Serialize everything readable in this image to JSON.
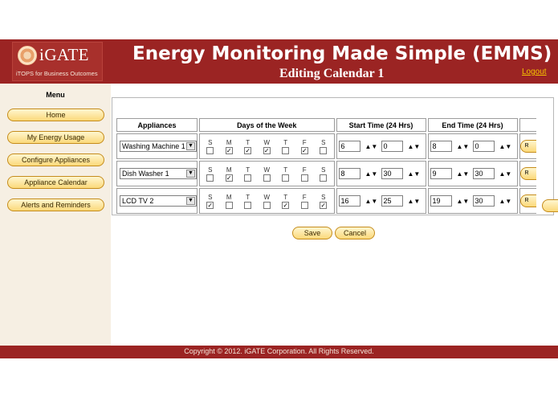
{
  "header": {
    "logo_text": "iGATE",
    "logo_tagline": "iTOPS for Business Outcomes",
    "app_title": "Energy Monitoring Made Simple (EMMS)",
    "page_subtitle": "Editing Calendar 1",
    "logout_label": "Logout"
  },
  "sidebar": {
    "menu_title": "Menu",
    "items": [
      {
        "label": "Home"
      },
      {
        "label": "My Energy Usage"
      },
      {
        "label": "Configure Appliances"
      },
      {
        "label": "Appliance Calendar"
      },
      {
        "label": "Alerts and Reminders"
      }
    ]
  },
  "schedule": {
    "headers": {
      "appliances": "Appliances",
      "days": "Days of the Week",
      "start": "Start Time (24 Hrs)",
      "end": "End Time (24 Hrs)"
    },
    "day_letters": [
      "S",
      "M",
      "T",
      "W",
      "T",
      "F",
      "S"
    ],
    "rows": [
      {
        "appliance": "Washing Machine 1",
        "days": [
          "",
          "✓",
          "✓",
          "✓",
          "",
          "✓",
          ""
        ],
        "start_hour": "6",
        "start_min": "0",
        "end_hour": "8",
        "end_min": "0",
        "row_button": "R"
      },
      {
        "appliance": "Dish Washer 1",
        "days": [
          "",
          "✓",
          "",
          "",
          "",
          "",
          ""
        ],
        "start_hour": "8",
        "start_min": "30",
        "end_hour": "9",
        "end_min": "30",
        "row_button": "R"
      },
      {
        "appliance": "LCD TV 2",
        "days": [
          "✓",
          "",
          "",
          "",
          "✓",
          "",
          "✓"
        ],
        "start_hour": "16",
        "start_min": "25",
        "end_hour": "19",
        "end_min": "30",
        "row_button": "R"
      }
    ],
    "select_arrow": "▼",
    "spin_arrows": "▲▼"
  },
  "actions": {
    "save_label": "Save",
    "cancel_label": "Cancel"
  },
  "footer": {
    "copyright": "Copyright © 2012. iGATE Corporation. All Rights Reserved."
  },
  "colors": {
    "brand": "#9b2423",
    "sidebar_bg": "#f6efe3",
    "button_fill": "#fbd97a",
    "logout_link": "#f5c400"
  }
}
